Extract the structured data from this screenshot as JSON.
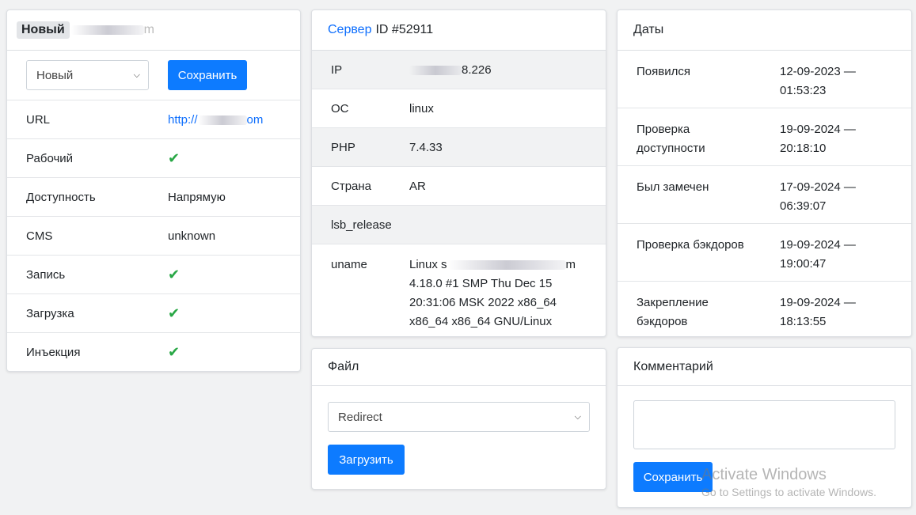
{
  "colors": {
    "accent": "#0d7bff",
    "check": "#28a745",
    "link": "#0d6efd"
  },
  "site": {
    "badge": "Новый",
    "title_tail": "m",
    "status_select": "Новый",
    "save_label": "Сохранить",
    "rows": [
      {
        "label": "URL",
        "value_prefix": "http://",
        "value_suffix": "om"
      },
      {
        "label": "Рабочий",
        "icon": "check-icon"
      },
      {
        "label": "Доступность",
        "value": "Напрямую"
      },
      {
        "label": "CMS",
        "value": "unknown"
      },
      {
        "label": "Запись",
        "icon": "check-icon"
      },
      {
        "label": "Загрузка",
        "icon": "check-icon"
      },
      {
        "label": "Инъекция",
        "icon": "check-icon"
      }
    ],
    "check_glyph": "✔"
  },
  "server": {
    "title_link": "Сервер",
    "title_id": "ID #52911",
    "rows": [
      {
        "label": "IP",
        "value": "8.226"
      },
      {
        "label": "ОС",
        "value": "linux"
      },
      {
        "label": "PHP",
        "value": "7.4.33"
      },
      {
        "label": "Страна",
        "value": "AR"
      },
      {
        "label": "lsb_release",
        "value": ""
      }
    ],
    "uname": {
      "label": "uname",
      "line1_prefix": "Linux s",
      "line1_suffix": "m",
      "line2": "4.18.0 #1 SMP Thu Dec 15",
      "line3": "20:31:06 MSK 2022 x86_64",
      "line4": "x86_64 x86_64 GNU/Linux"
    }
  },
  "dates": {
    "title": "Даты",
    "rows": [
      {
        "label1": "Появился",
        "label2": "",
        "date": "12-09-2023 —",
        "time": "01:53:23"
      },
      {
        "label1": "Проверка",
        "label2": "доступности",
        "date": "19-09-2024 —",
        "time": "20:18:10"
      },
      {
        "label1": "Был замечен",
        "label2": "",
        "date": "17-09-2024 —",
        "time": "06:39:07"
      },
      {
        "label1": "Проверка бэкдоров",
        "label2": "",
        "date": "19-09-2024 —",
        "time": "19:00:47"
      },
      {
        "label1": "Закрепление",
        "label2": "бэкдоров",
        "date": "19-09-2024 —",
        "time": "18:13:55"
      }
    ]
  },
  "file": {
    "title": "Файл",
    "select_value": "Redirect",
    "upload_label": "Загрузить"
  },
  "comment": {
    "title": "Комментарий",
    "textarea_value": "",
    "save_label": "Сохранить"
  },
  "watermark": {
    "line1": "Activate Windows",
    "line2": "Go to Settings to activate Windows."
  }
}
